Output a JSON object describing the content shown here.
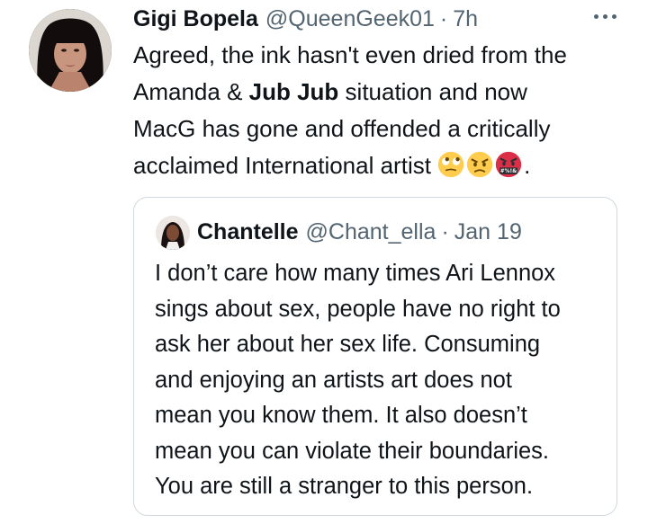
{
  "tweet": {
    "author_name": "Gigi Bopela",
    "author_handle": "@QueenGeek01",
    "separator": "·",
    "time": "7h",
    "lines": [
      {
        "pre": "Agreed, the ink hasn't even dried from the",
        "bold": "",
        "post": ""
      },
      {
        "pre": "Amanda & ",
        "bold": "Jub Jub",
        "post": " situation and now"
      },
      {
        "pre": "MacG has gone and offended a critically",
        "bold": "",
        "post": ""
      },
      {
        "pre": "acclaimed International artist ",
        "bold": "",
        "post": ""
      }
    ],
    "emojis": [
      "face-with-rolling-eyes-icon",
      "angry-face-icon",
      "face-with-symbols-on-mouth-icon"
    ],
    "trailing_text": ".",
    "cursing_symbols": "#%!&"
  },
  "quoted_tweet": {
    "author_name": "Chantelle",
    "author_handle": "@Chant_ella",
    "separator": "·",
    "time": "Jan 19",
    "lines": [
      "I don’t care how many times Ari Lennox",
      "sings about sex, people have no right to",
      "ask her about her sex life. Consuming",
      "and enjoying an artists art does not",
      "mean you know them. It also doesn’t",
      "mean you can violate their boundaries.",
      "You are still a stranger to this person."
    ]
  },
  "colors": {
    "text": "#0f1419",
    "secondary": "#536471",
    "border": "#cfd9de"
  }
}
